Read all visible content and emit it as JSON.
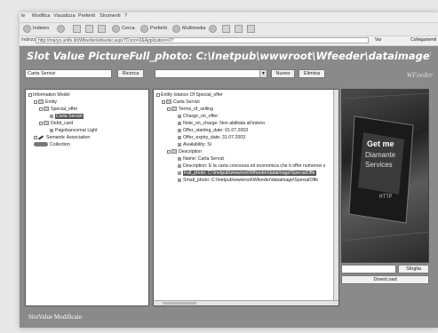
{
  "browser": {
    "menu": [
      "le",
      "Modifica",
      "Visualizza",
      "Preferiti",
      "Strumenti",
      "?"
    ],
    "toolbar": {
      "back": "Indietro",
      "search": "Cerca",
      "favorites": "Preferiti",
      "media": "Multimedia"
    },
    "address_label": "Indirizzo",
    "address": "http://marys.unife.it/xWfeeder/wfeeder.aspx?Conn=2&Application=27",
    "go": "Vai",
    "links": "Collegamenti"
  },
  "app": {
    "title": "Slot Value PictureFull_photo:  C:\\Inetpub\\wwwroot\\Wfeeder\\dataimage\\S",
    "logo": "WFeeder",
    "search_value": "Carta Servizi",
    "ricerca_label": "Ricerca",
    "nuovo_label": "Nuovo",
    "elimina_label": "Elimina",
    "left_tree": [
      "Information Model",
      "Entity",
      "Special_offer",
      "Carta Servizi",
      "Debit_card",
      "Pagobancomat Light",
      "Semantic Association",
      "Collection"
    ],
    "right_tree": [
      "Entity Istance Of Special_offer",
      "Carta Servizi",
      "Terms_of_selling",
      "Charge_on_offer:",
      "Note_on_charge: Non abilitata all'estero",
      "Offer_starting_date: 01.07.2003",
      "Offer_expiry_date: 31.07.2003",
      "Availability: Si",
      "Description",
      "Name: Carta Servizi",
      "Description: E la carta concessa ed economica che ti offre numerosi s",
      "Full_photo: C:\\Inetpub\\wwwroot\\Wfeeder\\dataimage\\SpecialOffe",
      "Small_photo: C:\\Inetpub\\wwwroot\\Wfeeder\\dataimage\\SpecialOffe"
    ],
    "image_text": {
      "line1": "Get me",
      "line2": "Diamante",
      "line3": "Services",
      "tag": "HTTP"
    },
    "sfoglia_label": "Sfoglia",
    "download_label": "DownLoad",
    "status": "SlotValue Modificato"
  }
}
